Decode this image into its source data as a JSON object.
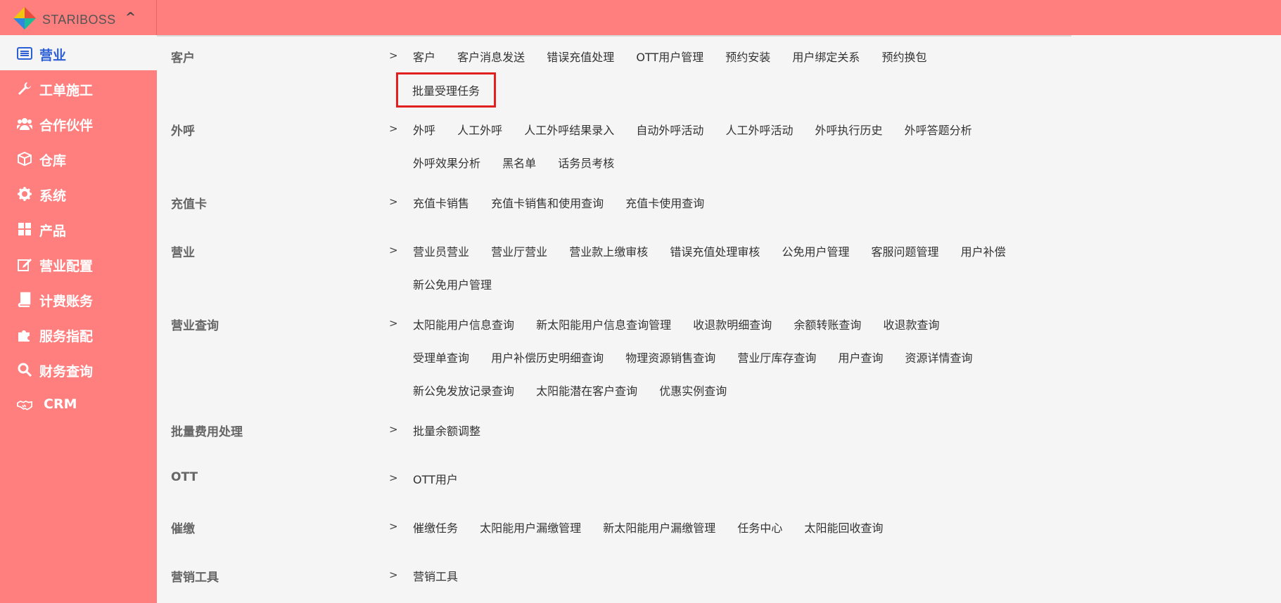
{
  "brand": {
    "name": "STARIBOSS",
    "toggle_icon": "chevron-up-icon"
  },
  "sidebar": {
    "items": [
      {
        "label": "营业",
        "icon": "list-icon",
        "active": true
      },
      {
        "label": "工单施工",
        "icon": "wrench-icon"
      },
      {
        "label": "合作伙伴",
        "icon": "users-icon"
      },
      {
        "label": "仓库",
        "icon": "cube-icon"
      },
      {
        "label": "系统",
        "icon": "gear-icon"
      },
      {
        "label": "产品",
        "icon": "grid-icon"
      },
      {
        "label": "营业配置",
        "icon": "edit-icon"
      },
      {
        "label": "计费账务",
        "icon": "book-icon"
      },
      {
        "label": "服务指配",
        "icon": "puzzle-icon"
      },
      {
        "label": "财务查询",
        "icon": "search-icon"
      },
      {
        "label": "CRM",
        "icon": "handshake-icon"
      }
    ]
  },
  "menu": {
    "arrow": ">",
    "rows": [
      {
        "category": "客户",
        "lines": [
          [
            "客户",
            "客户消息发送",
            "错误充值处理",
            "OTT用户管理",
            "预约安装",
            "用户绑定关系",
            "预约换包"
          ],
          [
            "批量受理任务"
          ]
        ]
      },
      {
        "category": "外呼",
        "lines": [
          [
            "外呼",
            "人工外呼",
            "人工外呼结果录入",
            "自动外呼活动",
            "人工外呼活动",
            "外呼执行历史",
            "外呼答题分析"
          ],
          [
            "外呼效果分析",
            "黑名单",
            "话务员考核"
          ]
        ]
      },
      {
        "category": "充值卡",
        "lines": [
          [
            "充值卡销售",
            "充值卡销售和使用查询",
            "充值卡使用查询"
          ]
        ]
      },
      {
        "category": "营业",
        "lines": [
          [
            "营业员营业",
            "营业厅营业",
            "营业款上缴审核",
            "错误充值处理审核",
            "公免用户管理",
            "客服问题管理",
            "用户补偿"
          ],
          [
            "新公免用户管理"
          ]
        ]
      },
      {
        "category": "营业查询",
        "lines": [
          [
            "太阳能用户信息查询",
            "新太阳能用户信息查询管理",
            "收退款明细查询",
            "余额转账查询",
            "收退款查询"
          ],
          [
            "受理单查询",
            "用户补偿历史明细查询",
            "物理资源销售查询",
            "营业厅库存查询",
            "用户查询",
            "资源详情查询"
          ],
          [
            "新公免发放记录查询",
            "太阳能潜在客户查询",
            "优惠实例查询"
          ]
        ]
      },
      {
        "category": "批量费用处理",
        "lines": [
          [
            "批量余额调整"
          ]
        ]
      },
      {
        "category": "OTT",
        "lines": [
          [
            "OTT用户"
          ]
        ]
      },
      {
        "category": "催缴",
        "lines": [
          [
            "催缴任务",
            "太阳能用户漏缴管理",
            "新太阳能用户漏缴管理",
            "任务中心",
            "太阳能回收查询"
          ]
        ]
      },
      {
        "category": "营销工具",
        "lines": [
          [
            "营销工具"
          ]
        ]
      }
    ],
    "highlighted_item": "批量受理任务"
  },
  "colors": {
    "primary": "#ff7f7f",
    "active_text": "#2c5fd6",
    "highlight_border": "#e0211f"
  }
}
